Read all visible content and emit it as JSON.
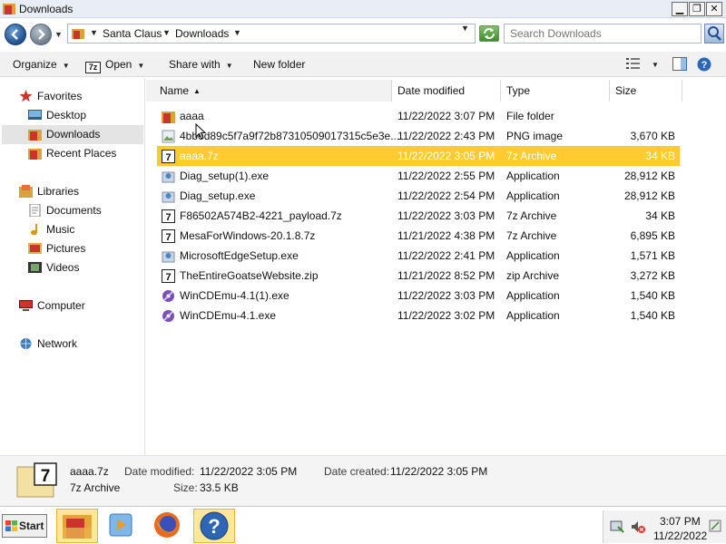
{
  "window": {
    "title": "Downloads"
  },
  "address": {
    "crumbs": [
      "Santa Claus",
      "Downloads"
    ],
    "search_placeholder": "Search Downloads"
  },
  "toolbar": {
    "organize": "Organize",
    "open": "Open",
    "open_icon_text": "7z",
    "share_with": "Share with",
    "new_folder": "New folder"
  },
  "nav": {
    "favorites": "Favorites",
    "desktop": "Desktop",
    "downloads": "Downloads",
    "recent_places": "Recent Places",
    "libraries": "Libraries",
    "documents": "Documents",
    "music": "Music",
    "pictures": "Pictures",
    "videos": "Videos",
    "computer": "Computer",
    "network": "Network"
  },
  "columns": {
    "name": "Name",
    "date_modified": "Date modified",
    "type": "Type",
    "size": "Size"
  },
  "files": [
    {
      "name": "aaaa",
      "date": "11/22/2022 3:07 PM",
      "type": "File folder",
      "size": "",
      "icon": "folder-icon"
    },
    {
      "name": "4bbed89c5f7a9f72b87310509017315c5e3e...",
      "date": "11/22/2022 2:43 PM",
      "type": "PNG image",
      "size": "3,670 KB",
      "icon": "image-icon"
    },
    {
      "name": "aaaa.7z",
      "date": "11/22/2022 3:05 PM",
      "type": "7z Archive",
      "size": "34 KB",
      "icon": "archive-7z-icon",
      "selected": true
    },
    {
      "name": "Diag_setup(1).exe",
      "date": "11/22/2022 2:55 PM",
      "type": "Application",
      "size": "28,912 KB",
      "icon": "installer-icon"
    },
    {
      "name": "Diag_setup.exe",
      "date": "11/22/2022 2:54 PM",
      "type": "Application",
      "size": "28,912 KB",
      "icon": "installer-icon"
    },
    {
      "name": "F86502A574B2-4221_payload.7z",
      "date": "11/22/2022 3:03 PM",
      "type": "7z Archive",
      "size": "34 KB",
      "icon": "archive-7z-icon"
    },
    {
      "name": "MesaForWindows-20.1.8.7z",
      "date": "11/21/2022 4:38 PM",
      "type": "7z Archive",
      "size": "6,895 KB",
      "icon": "archive-7z-icon"
    },
    {
      "name": "MicrosoftEdgeSetup.exe",
      "date": "11/22/2022 2:41 PM",
      "type": "Application",
      "size": "1,571 KB",
      "icon": "installer-icon"
    },
    {
      "name": "TheEntireGoatseWebsite.zip",
      "date": "11/21/2022 8:52 PM",
      "type": "zip Archive",
      "size": "3,272 KB",
      "icon": "archive-zip-icon"
    },
    {
      "name": "WinCDEmu-4.1(1).exe",
      "date": "11/22/2022 3:03 PM",
      "type": "Application",
      "size": "1,540 KB",
      "icon": "wincdemu-icon"
    },
    {
      "name": "WinCDEmu-4.1.exe",
      "date": "11/22/2022 3:02 PM",
      "type": "Application",
      "size": "1,540 KB",
      "icon": "wincdemu-icon"
    }
  ],
  "details": {
    "icon_text": "7",
    "filename": "aaaa.7z",
    "filetype": "7z Archive",
    "date_modified_label": "Date modified:",
    "date_modified": "11/22/2022 3:05 PM",
    "date_created_label": "Date created:",
    "date_created": "11/22/2022 3:05 PM",
    "size_label": "Size:",
    "size": "33.5 KB"
  },
  "taskbar": {
    "start": "Start",
    "apps": [
      "file-explorer-icon",
      "media-player-icon",
      "firefox-icon",
      "help-icon"
    ],
    "time": "3:07 PM",
    "date": "11/22/2022"
  },
  "colors": {
    "selection": "#ffcb2e",
    "accent_blue": "#1f4f8c",
    "folder_red": "#c8352b"
  }
}
